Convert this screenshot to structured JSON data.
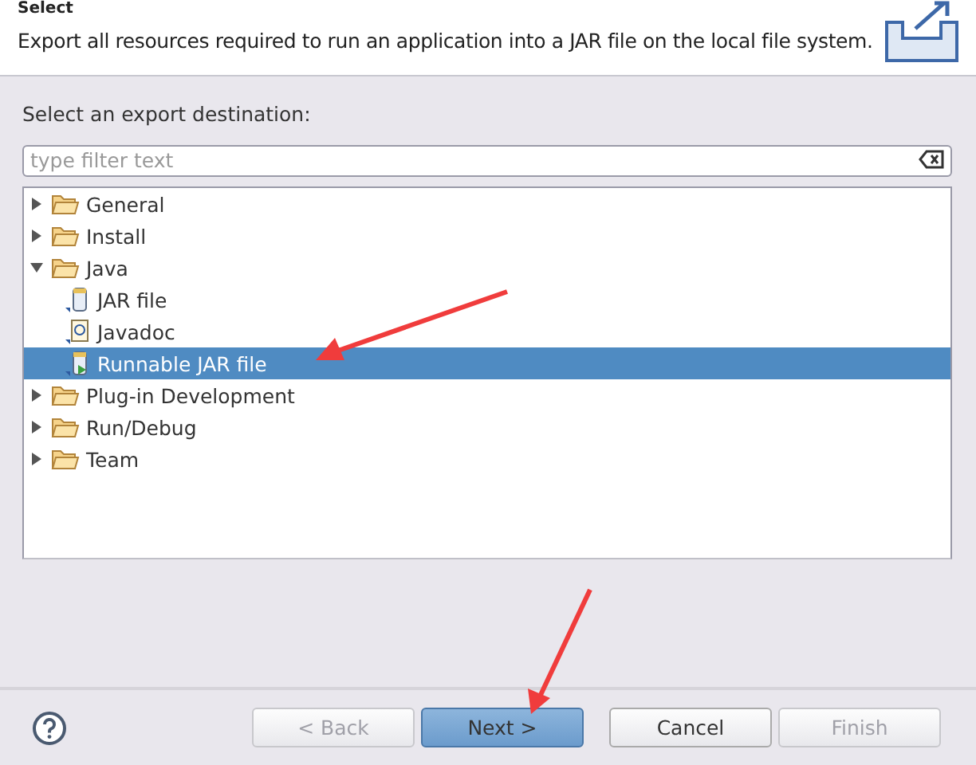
{
  "header": {
    "title": "Select",
    "description": "Export all resources required to run an application into a JAR file on the local file system."
  },
  "destination_label": "Select an export destination:",
  "filter": {
    "placeholder": "type filter text"
  },
  "tree": [
    {
      "label": "General",
      "kind": "folder",
      "expanded": false,
      "selected": false
    },
    {
      "label": "Install",
      "kind": "folder",
      "expanded": false,
      "selected": false
    },
    {
      "label": "Java",
      "kind": "folder",
      "expanded": true,
      "selected": false,
      "children": [
        {
          "label": "JAR file",
          "kind": "jar",
          "selected": false
        },
        {
          "label": "Javadoc",
          "kind": "javadoc",
          "selected": false
        },
        {
          "label": "Runnable JAR file",
          "kind": "runnable-jar",
          "selected": true
        }
      ]
    },
    {
      "label": "Plug-in Development",
      "kind": "folder",
      "expanded": false,
      "selected": false
    },
    {
      "label": "Run/Debug",
      "kind": "folder",
      "expanded": false,
      "selected": false
    },
    {
      "label": "Team",
      "kind": "folder",
      "expanded": false,
      "selected": false
    }
  ],
  "buttons": [
    {
      "label": "< Back",
      "disabled": true,
      "default": false
    },
    {
      "label": "Next >",
      "disabled": false,
      "default": true
    },
    {
      "label": "Cancel",
      "disabled": false,
      "default": false
    },
    {
      "label": "Finish",
      "disabled": true,
      "default": false
    }
  ]
}
